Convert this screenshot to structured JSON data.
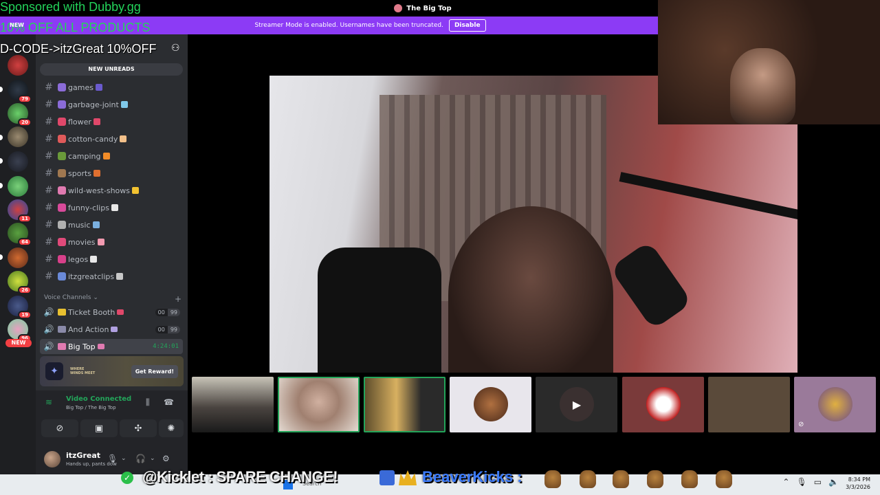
{
  "overlay": {
    "sponsor_line1": "Sponsored with Dubby.gg",
    "sponsor_line2": "10% OFF ALL PRODUCTS",
    "sponsor_line3": "D-CODE->itzGreat 10%OFF",
    "new_label": "NEW"
  },
  "window": {
    "title": "The Big Top"
  },
  "streamer_banner": {
    "message": "Streamer Mode is enabled. Usernames have been truncated.",
    "button": "Disable"
  },
  "server_rail": {
    "badges": [
      "79",
      "20",
      "11",
      "64",
      "26",
      "19",
      "96"
    ],
    "new_pill": "NEW"
  },
  "sidebar": {
    "new_unreads": "NEW UNREADS",
    "channels": [
      {
        "name": "games",
        "emoji_color": "#8b6cd8",
        "emoji2": "#6a5acd"
      },
      {
        "name": "garbage-joint",
        "emoji_color": "#8b6cd8",
        "emoji2": "#7fc8e8"
      },
      {
        "name": "flower",
        "emoji_color": "#e0486a",
        "emoji2": "#e0486a"
      },
      {
        "name": "cotton-candy",
        "emoji_color": "#e05a5a",
        "emoji2": "#f2c08a"
      },
      {
        "name": "camping",
        "emoji_color": "#6a9a3a",
        "emoji2": "#f28c28"
      },
      {
        "name": "sports",
        "emoji_color": "#a07850",
        "emoji2": "#e07030"
      },
      {
        "name": "wild-west-shows",
        "emoji_color": "#e07ab0",
        "emoji2": "#f2c230"
      },
      {
        "name": "funny-clips",
        "emoji_color": "#d84a9a",
        "emoji2": "#e8e8e8"
      },
      {
        "name": "music",
        "emoji_color": "#b0b0b0",
        "emoji2": "#7ab0e0"
      },
      {
        "name": "movies",
        "emoji_color": "#e04a7a",
        "emoji2": "#f29ab0"
      },
      {
        "name": "legos",
        "emoji_color": "#d8408a",
        "emoji2": "#e8e8e8"
      },
      {
        "name": "itzgreatclips",
        "emoji_color": "#6a8ad8",
        "emoji2": "#c8c8c8"
      }
    ],
    "voice_header": "Voice Channels",
    "voice_channels": [
      {
        "name": "Ticket Booth",
        "count": "00",
        "limit": "99",
        "emoji_color": "#e8c030",
        "emoji2": "#e0486a"
      },
      {
        "name": "And Action",
        "count": "00",
        "limit": "99",
        "emoji_color": "#8a8aa8",
        "emoji2": "#b0a0e0"
      }
    ],
    "active_voice": {
      "name": "Big Top",
      "timer": "4:24:01"
    },
    "promo_button": "Get Reward!",
    "promo_text": "WHERE WINDS MEET",
    "voice_status": "Video Connected",
    "voice_sub": "Big Top / The Big Top",
    "user": {
      "name": "itzGreat",
      "status": "Hands up, pants dow"
    }
  },
  "chat_overlay": {
    "kicklet": "@Kicklet : SPARE CHANGE!",
    "beaver": "BeaverKicks :"
  },
  "system_tray": {
    "time": "8:34 PM",
    "date": "3/3/2026"
  },
  "taskbar": {
    "search_placeholder": "Search"
  }
}
